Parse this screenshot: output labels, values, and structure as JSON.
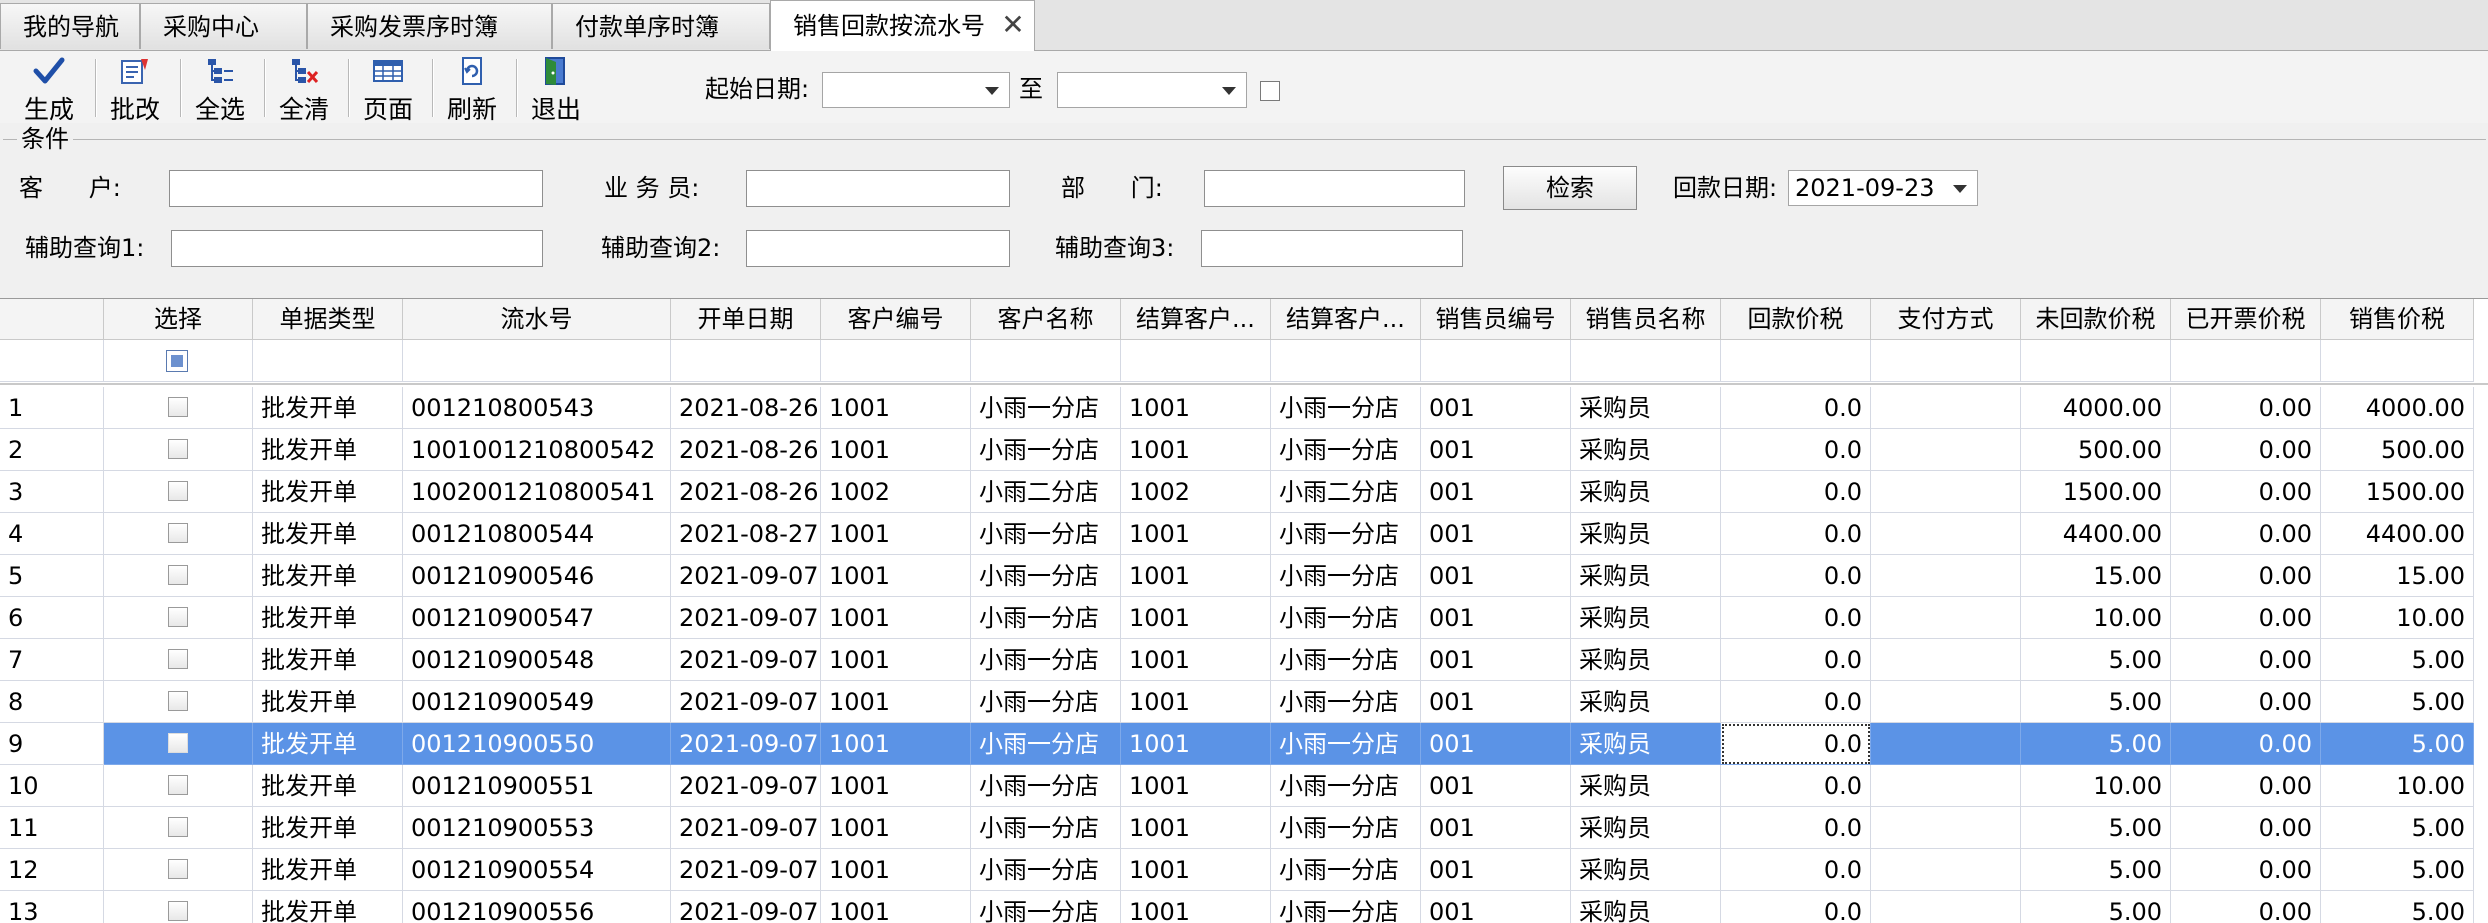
{
  "tabs": [
    {
      "label": "我的导航"
    },
    {
      "label": "采购中心"
    },
    {
      "label": "采购发票序时簿"
    },
    {
      "label": "付款单序时簿"
    },
    {
      "label": "销售回款按流水号"
    }
  ],
  "toolbar": {
    "buttons": [
      {
        "label": "生成",
        "icon": "check-icon"
      },
      {
        "label": "批改",
        "icon": "batch-edit-icon"
      },
      {
        "label": "全选",
        "icon": "select-all-icon"
      },
      {
        "label": "全清",
        "icon": "clear-all-icon"
      },
      {
        "label": "页面",
        "icon": "page-icon"
      },
      {
        "label": "刷新",
        "icon": "refresh-icon"
      },
      {
        "label": "退出",
        "icon": "exit-icon"
      }
    ],
    "start_date_label": "起始日期:",
    "start_date_value": "",
    "to_label": "至",
    "end_date_value": ""
  },
  "conditions": {
    "title": "条件",
    "customer_label": "客      户:",
    "customer_value": "",
    "salesman_label": "业 务 员:",
    "salesman_value": "",
    "dept_label": "部      门:",
    "dept_value": "",
    "search_label": "检索",
    "payment_date_label": "回款日期:",
    "payment_date_value": "2021-09-23",
    "aux1_label": "辅助查询1:",
    "aux1_value": "",
    "aux2_label": "辅助查询2:",
    "aux2_value": "",
    "aux3_label": "辅助查询3:",
    "aux3_value": ""
  },
  "grid": {
    "columns": [
      "",
      "选择",
      "单据类型",
      "流水号",
      "开单日期",
      "客户编号",
      "客户名称",
      "结算客户...",
      "结算客户...",
      "销售员编号",
      "销售员名称",
      "回款价税",
      "支付方式",
      "未回款价税",
      "已开票价税",
      "销售价税"
    ],
    "rows": [
      {
        "no": "1",
        "type": "批发开单",
        "serial": "001210800543",
        "date": "2021-08-26",
        "cust_code": "1001",
        "cust_name": "小雨一分店",
        "settle_code": "1001",
        "settle_name": "小雨一分店",
        "sales_code": "001",
        "sales_name": "采购员",
        "payment": "0.0",
        "pay_method": "",
        "unpaid": "4000.00",
        "invoiced": "0.00",
        "sales_tax": "4000.00"
      },
      {
        "no": "2",
        "type": "批发开单",
        "serial": "1001001210800542",
        "date": "2021-08-26",
        "cust_code": "1001",
        "cust_name": "小雨一分店",
        "settle_code": "1001",
        "settle_name": "小雨一分店",
        "sales_code": "001",
        "sales_name": "采购员",
        "payment": "0.0",
        "pay_method": "",
        "unpaid": "500.00",
        "invoiced": "0.00",
        "sales_tax": "500.00"
      },
      {
        "no": "3",
        "type": "批发开单",
        "serial": "1002001210800541",
        "date": "2021-08-26",
        "cust_code": "1002",
        "cust_name": "小雨二分店",
        "settle_code": "1002",
        "settle_name": "小雨二分店",
        "sales_code": "001",
        "sales_name": "采购员",
        "payment": "0.0",
        "pay_method": "",
        "unpaid": "1500.00",
        "invoiced": "0.00",
        "sales_tax": "1500.00"
      },
      {
        "no": "4",
        "type": "批发开单",
        "serial": "001210800544",
        "date": "2021-08-27",
        "cust_code": "1001",
        "cust_name": "小雨一分店",
        "settle_code": "1001",
        "settle_name": "小雨一分店",
        "sales_code": "001",
        "sales_name": "采购员",
        "payment": "0.0",
        "pay_method": "",
        "unpaid": "4400.00",
        "invoiced": "0.00",
        "sales_tax": "4400.00"
      },
      {
        "no": "5",
        "type": "批发开单",
        "serial": "001210900546",
        "date": "2021-09-07",
        "cust_code": "1001",
        "cust_name": "小雨一分店",
        "settle_code": "1001",
        "settle_name": "小雨一分店",
        "sales_code": "001",
        "sales_name": "采购员",
        "payment": "0.0",
        "pay_method": "",
        "unpaid": "15.00",
        "invoiced": "0.00",
        "sales_tax": "15.00"
      },
      {
        "no": "6",
        "type": "批发开单",
        "serial": "001210900547",
        "date": "2021-09-07",
        "cust_code": "1001",
        "cust_name": "小雨一分店",
        "settle_code": "1001",
        "settle_name": "小雨一分店",
        "sales_code": "001",
        "sales_name": "采购员",
        "payment": "0.0",
        "pay_method": "",
        "unpaid": "10.00",
        "invoiced": "0.00",
        "sales_tax": "10.00"
      },
      {
        "no": "7",
        "type": "批发开单",
        "serial": "001210900548",
        "date": "2021-09-07",
        "cust_code": "1001",
        "cust_name": "小雨一分店",
        "settle_code": "1001",
        "settle_name": "小雨一分店",
        "sales_code": "001",
        "sales_name": "采购员",
        "payment": "0.0",
        "pay_method": "",
        "unpaid": "5.00",
        "invoiced": "0.00",
        "sales_tax": "5.00"
      },
      {
        "no": "8",
        "type": "批发开单",
        "serial": "001210900549",
        "date": "2021-09-07",
        "cust_code": "1001",
        "cust_name": "小雨一分店",
        "settle_code": "1001",
        "settle_name": "小雨一分店",
        "sales_code": "001",
        "sales_name": "采购员",
        "payment": "0.0",
        "pay_method": "",
        "unpaid": "5.00",
        "invoiced": "0.00",
        "sales_tax": "5.00"
      },
      {
        "no": "9",
        "type": "批发开单",
        "serial": "001210900550",
        "date": "2021-09-07",
        "cust_code": "1001",
        "cust_name": "小雨一分店",
        "settle_code": "1001",
        "settle_name": "小雨一分店",
        "sales_code": "001",
        "sales_name": "采购员",
        "payment": "0.0",
        "pay_method": "",
        "unpaid": "5.00",
        "invoiced": "0.00",
        "sales_tax": "5.00",
        "selected": true
      },
      {
        "no": "10",
        "type": "批发开单",
        "serial": "001210900551",
        "date": "2021-09-07",
        "cust_code": "1001",
        "cust_name": "小雨一分店",
        "settle_code": "1001",
        "settle_name": "小雨一分店",
        "sales_code": "001",
        "sales_name": "采购员",
        "payment": "0.0",
        "pay_method": "",
        "unpaid": "10.00",
        "invoiced": "0.00",
        "sales_tax": "10.00"
      },
      {
        "no": "11",
        "type": "批发开单",
        "serial": "001210900553",
        "date": "2021-09-07",
        "cust_code": "1001",
        "cust_name": "小雨一分店",
        "settle_code": "1001",
        "settle_name": "小雨一分店",
        "sales_code": "001",
        "sales_name": "采购员",
        "payment": "0.0",
        "pay_method": "",
        "unpaid": "5.00",
        "invoiced": "0.00",
        "sales_tax": "5.00"
      },
      {
        "no": "12",
        "type": "批发开单",
        "serial": "001210900554",
        "date": "2021-09-07",
        "cust_code": "1001",
        "cust_name": "小雨一分店",
        "settle_code": "1001",
        "settle_name": "小雨一分店",
        "sales_code": "001",
        "sales_name": "采购员",
        "payment": "0.0",
        "pay_method": "",
        "unpaid": "5.00",
        "invoiced": "0.00",
        "sales_tax": "5.00"
      },
      {
        "no": "13",
        "type": "批发开单",
        "serial": "001210900556",
        "date": "2021-09-07",
        "cust_code": "1001",
        "cust_name": "小雨一分店",
        "settle_code": "1001",
        "settle_name": "小雨一分店",
        "sales_code": "001",
        "sales_name": "采购员",
        "payment": "0.0",
        "pay_method": "",
        "unpaid": "5.00",
        "invoiced": "0.00",
        "sales_tax": "5.00"
      }
    ]
  },
  "colors": {
    "selection": "#5b93e6",
    "tab_active": "#ffffff"
  }
}
